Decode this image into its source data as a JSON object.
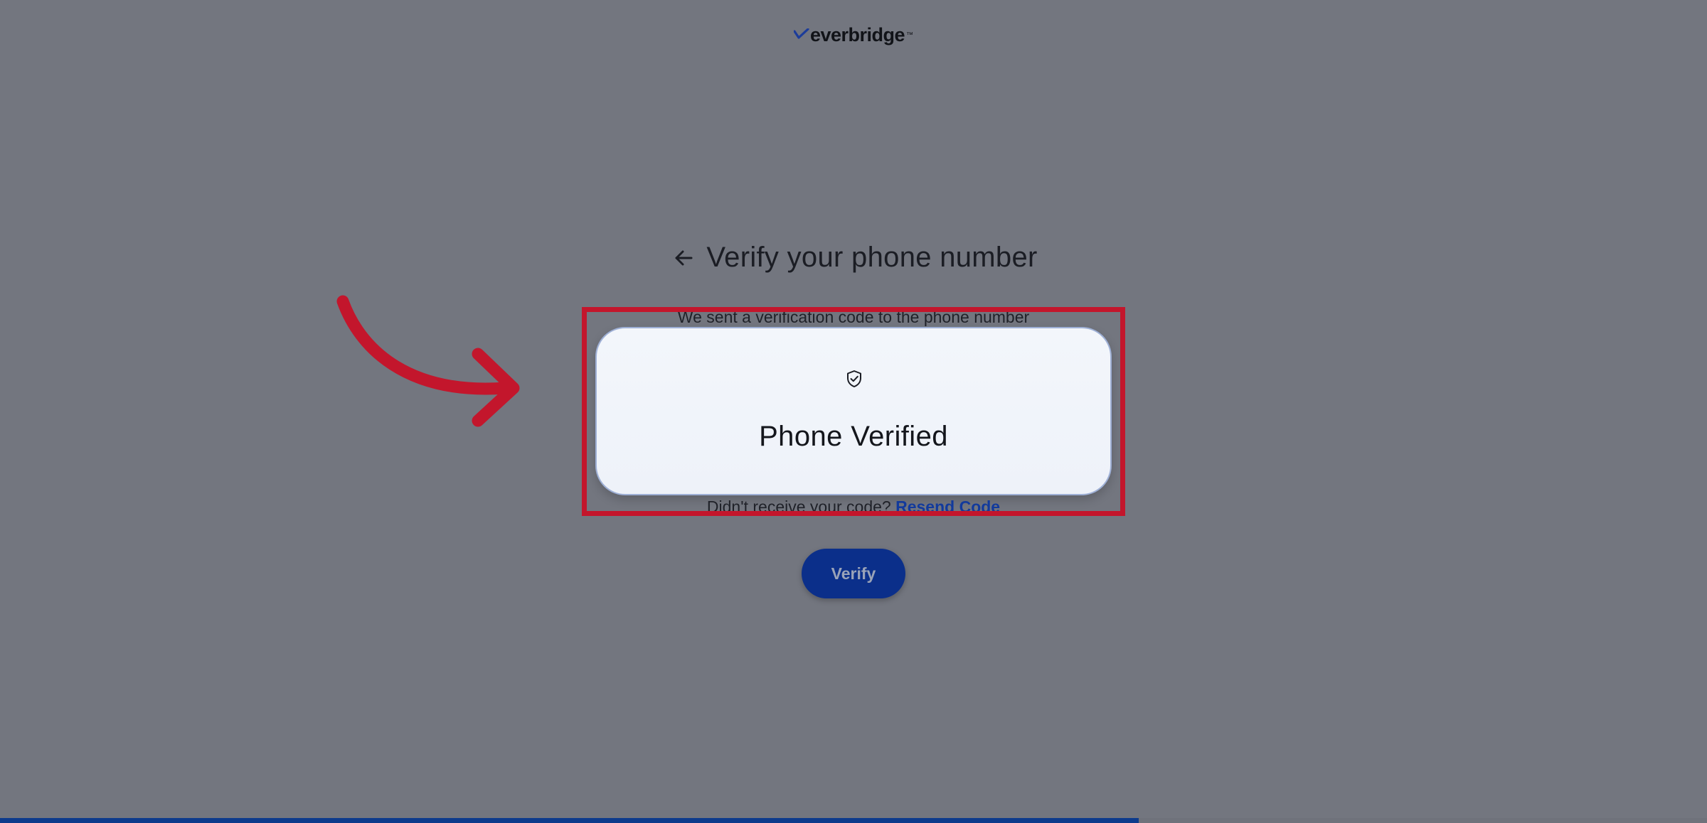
{
  "brand": {
    "logo_text": "everbridge",
    "trademark": "™"
  },
  "header": {
    "title": "Verify your phone number"
  },
  "instructions": {
    "sent_text": "We sent a verification code to the phone number"
  },
  "status_card": {
    "label": "Phone Verified",
    "icon": "shield-check-icon"
  },
  "resend": {
    "prompt": "Didn't receive your code?",
    "link_label": "Resend Code"
  },
  "actions": {
    "verify_label": "Verify"
  },
  "progress": {
    "fraction": 0.667
  },
  "colors": {
    "overlay_background": "#73767f",
    "highlight_border": "#c3162c",
    "annotation_arrow": "#c3162c",
    "primary_button": "#0b2f8a",
    "link": "#123a9c",
    "progress_fill": "#0d3b8c"
  }
}
